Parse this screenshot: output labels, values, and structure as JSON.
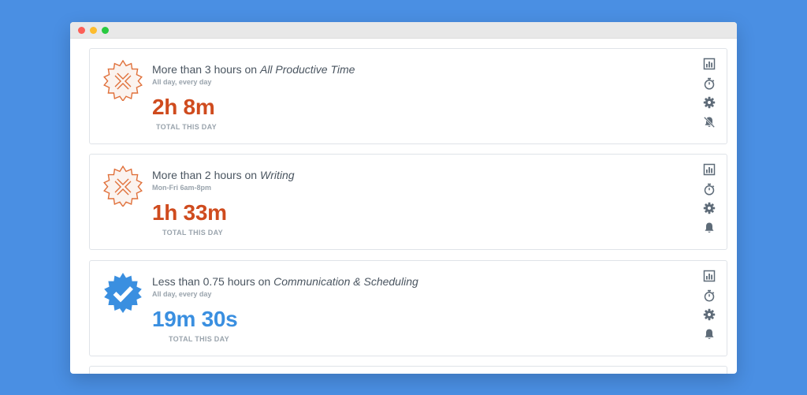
{
  "window": {
    "controls": [
      "close",
      "minimize",
      "zoom"
    ]
  },
  "colors": {
    "background": "#4a8fe3",
    "fail": "#cf4b1e",
    "success": "#3a8fe0",
    "icon": "#5e6b78"
  },
  "goals": [
    {
      "status": "failed",
      "badge_icon": "x-badge-icon",
      "title_prefix": "More than 3 hours on ",
      "category": "All Productive Time",
      "schedule": "All day, every day",
      "total": "2h 8m",
      "total_label": "TOTAL THIS DAY",
      "actions": [
        "chart-icon",
        "stopwatch-icon",
        "gear-icon",
        "bell-muted-icon"
      ]
    },
    {
      "status": "failed",
      "badge_icon": "x-badge-icon",
      "title_prefix": "More than 2 hours on ",
      "category": "Writing",
      "schedule": "Mon-Fri 6am-8pm",
      "total": "1h 33m",
      "total_label": "TOTAL THIS DAY",
      "actions": [
        "chart-icon",
        "stopwatch-icon",
        "gear-icon",
        "bell-icon"
      ]
    },
    {
      "status": "passed",
      "badge_icon": "check-badge-icon",
      "title_prefix": "Less than 0.75 hours on ",
      "category": "Communication & Scheduling",
      "schedule": "All day, every day",
      "total": "19m 30s",
      "total_label": "TOTAL THIS DAY",
      "actions": [
        "chart-icon",
        "stopwatch-icon",
        "gear-icon",
        "bell-icon"
      ]
    }
  ]
}
